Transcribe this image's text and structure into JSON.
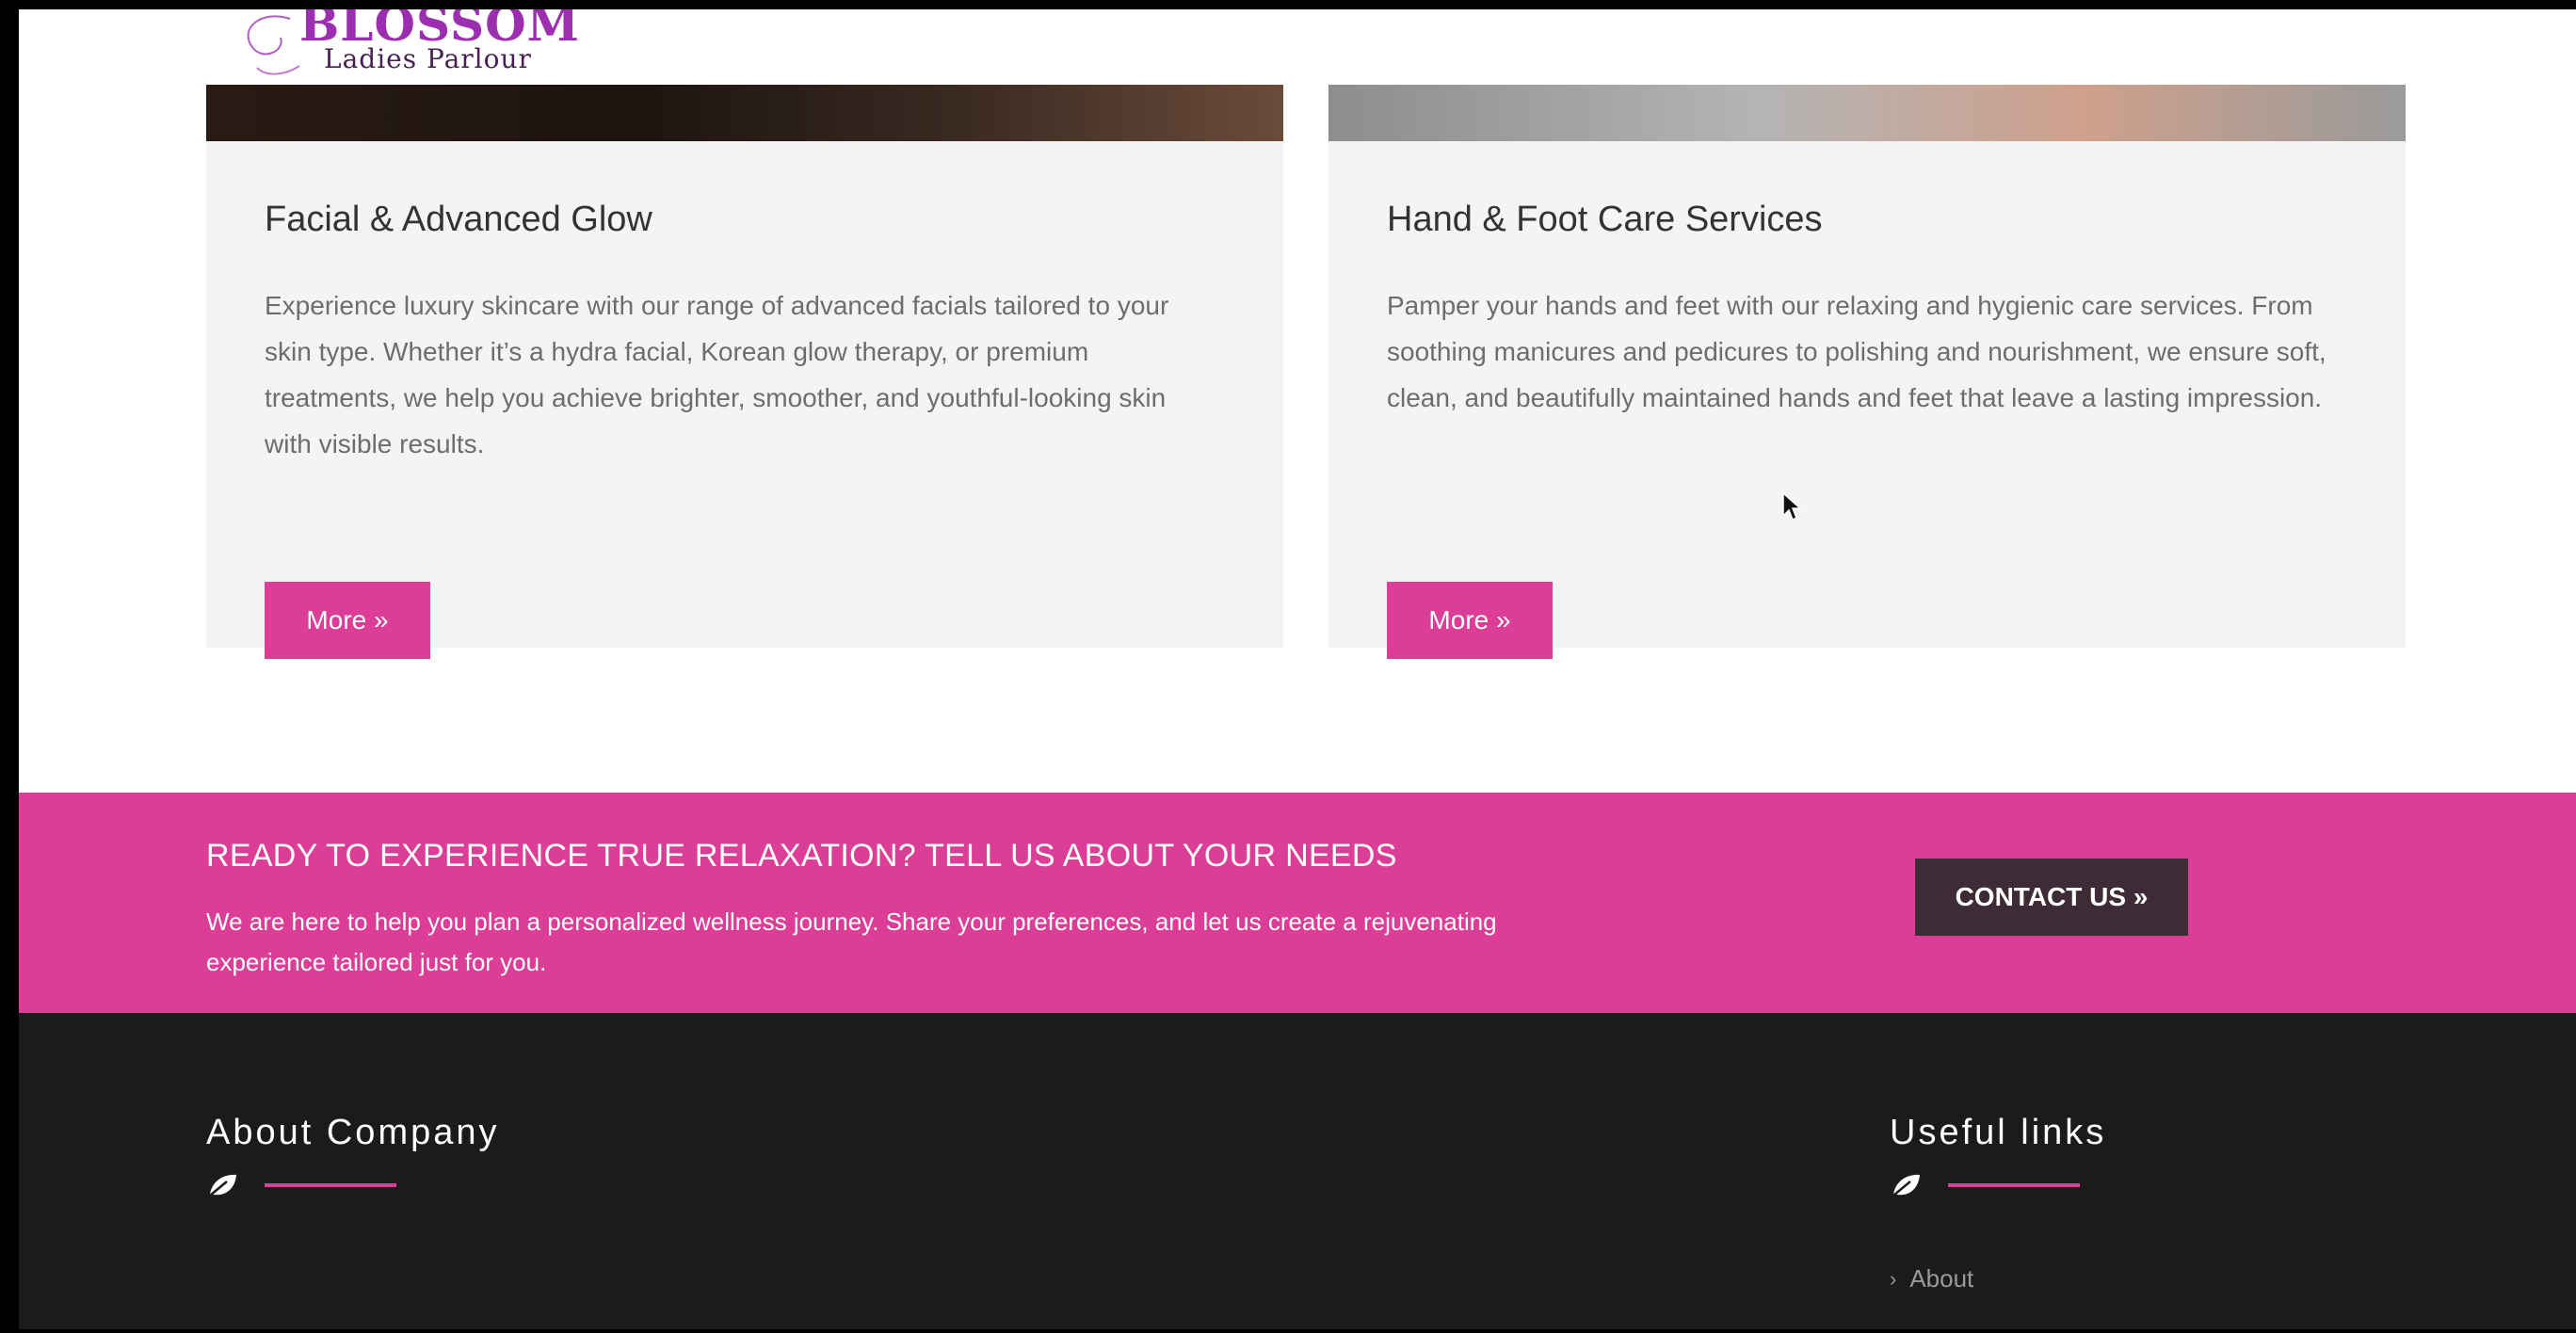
{
  "brand": {
    "name": "BLOSSOM",
    "tagline": "Ladies Parlour"
  },
  "cards": [
    {
      "title": "Facial & Advanced Glow",
      "text": "Experience luxury skincare with our range of advanced facials tailored to your skin type. Whether it’s a hydra facial, Korean glow therapy, or premium treatments, we help you achieve brighter, smoother, and youthful-looking skin with visible results.",
      "button": "More »"
    },
    {
      "title": "Hand & Foot Care Services",
      "text": "Pamper your hands and feet with our relaxing and hygienic care services. From soothing manicures and pedicures to polishing and nourishment, we ensure soft, clean, and beautifully maintained hands and feet that leave a lasting impression.",
      "button": "More »"
    }
  ],
  "cta": {
    "title": "READY TO EXPERIENCE TRUE RELAXATION? TELL US ABOUT YOUR NEEDS",
    "text": "We are here to help you plan a personalized wellness journey. Share your preferences, and let us create a rejuvenating experience tailored just for you.",
    "button": "CONTACT US »"
  },
  "footer": {
    "about_heading": "About Company",
    "links_heading": "Useful links",
    "links": [
      "About"
    ]
  },
  "colors": {
    "accent": "#dc3d96",
    "footer_bg": "#1b1b1b",
    "contact_button": "#3d2c35"
  },
  "icons": [
    "leaf-icon",
    "chevron-right-icon",
    "mouse-cursor-icon"
  ]
}
